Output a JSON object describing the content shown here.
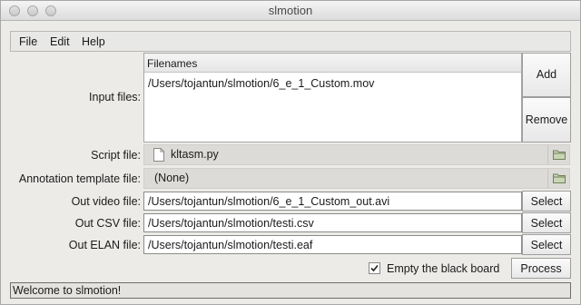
{
  "window": {
    "title": "slmotion"
  },
  "menubar": {
    "items": [
      "File",
      "Edit",
      "Help"
    ]
  },
  "input_files": {
    "label": "Input files:",
    "column_header": "Filenames",
    "files": [
      "/Users/tojantun/slmotion/6_e_1_Custom.mov"
    ],
    "add_label": "Add",
    "remove_label": "Remove"
  },
  "script_file": {
    "label": "Script file:",
    "value": "kltasm.py"
  },
  "annotation_template": {
    "label": "Annotation template file:",
    "value": "(None)"
  },
  "out_video": {
    "label": "Out video file:",
    "value": "/Users/tojantun/slmotion/6_e_1_Custom_out.avi",
    "button": "Select"
  },
  "out_csv": {
    "label": "Out CSV file:",
    "value": "/Users/tojantun/slmotion/testi.csv",
    "button": "Select"
  },
  "out_elan": {
    "label": "Out ELAN file:",
    "value": "/Users/tojantun/slmotion/testi.eaf",
    "button": "Select"
  },
  "options": {
    "empty_black_board_label": "Empty the black board",
    "empty_black_board_checked": true,
    "process_label": "Process"
  },
  "status": {
    "message": "Welcome to slmotion!"
  }
}
